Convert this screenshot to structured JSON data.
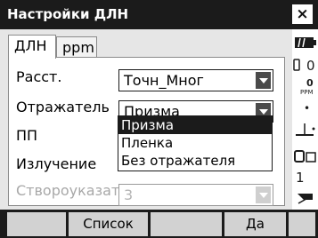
{
  "window": {
    "title": "Настройки ДЛН",
    "close_glyph": "×"
  },
  "tabs": [
    {
      "label": "ДЛН",
      "active": true
    },
    {
      "label": "ppm",
      "active": false
    }
  ],
  "form": {
    "rasst": {
      "label": "Расст.",
      "value": "Точн_Мног"
    },
    "reflector": {
      "label": "Отражатель",
      "value": "Призма"
    },
    "pp": {
      "label": "ПП"
    },
    "emission": {
      "label": "Излучение"
    },
    "stvor": {
      "label": "Створоуказат",
      "value": "3",
      "disabled": true
    }
  },
  "dropdown": {
    "options": [
      "Призма",
      "Пленка",
      "Без отражателя"
    ],
    "selected_index": 0
  },
  "sidebar": {
    "battery_icon": "battery-icon",
    "prism_constant": "0",
    "ppm_value": "0",
    "ppm_label": "PPM",
    "target_icon": "target-icon",
    "laser_icon": "laser-plummet-icon",
    "mode_icon": "display-mode-icon",
    "face_label": "1",
    "signal_icon": "signal-icon"
  },
  "softkeys": [
    "",
    "Список",
    "",
    "Да",
    ""
  ],
  "colors": {
    "titlebar": "#1b1b1b",
    "client_bg": "#e6e6e6",
    "softkey_bg": "#d2d2d2"
  }
}
